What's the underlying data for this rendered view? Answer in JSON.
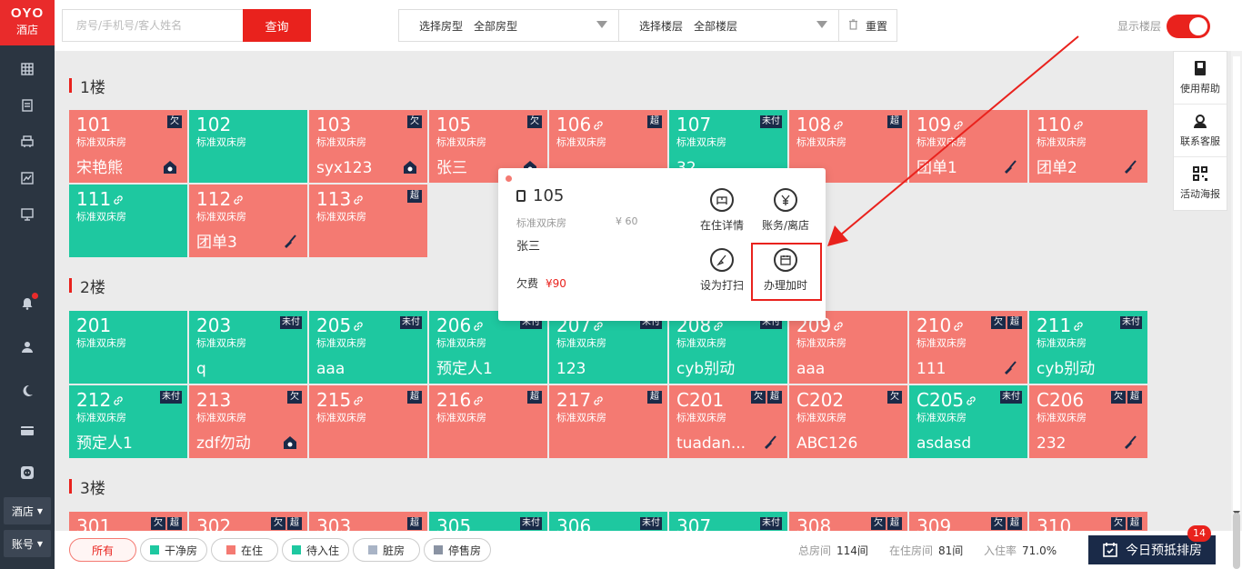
{
  "brand": {
    "line1": "OYO",
    "line2": "酒店"
  },
  "nav": {
    "hotel_label": "酒店",
    "account_label": "账号"
  },
  "topbar": {
    "search_placeholder": "房号/手机号/客人姓名",
    "query_label": "查询",
    "room_type_label": "选择房型",
    "room_type_value": "全部房型",
    "floor_label": "选择楼层",
    "floor_value": "全部楼层",
    "reset_label": "重置",
    "show_floor_label": "显示楼层"
  },
  "floors": [
    {
      "title": "1楼",
      "rooms": [
        {
          "num": "101",
          "type": "标准双床房",
          "guest": "宋艳熊",
          "color": "r",
          "badges": [
            "欠"
          ],
          "link": false,
          "icon": "home"
        },
        {
          "num": "102",
          "type": "标准双床房",
          "guest": "",
          "color": "c",
          "badges": [],
          "link": false,
          "icon": ""
        },
        {
          "num": "103",
          "type": "标准双床房",
          "guest": "syx123",
          "color": "r",
          "badges": [
            "欠"
          ],
          "link": false,
          "icon": "home"
        },
        {
          "num": "105",
          "type": "标准双床房",
          "guest": "张三",
          "color": "r",
          "badges": [
            "欠"
          ],
          "link": false,
          "icon": "home"
        },
        {
          "num": "106",
          "type": "标准双床房",
          "guest": "",
          "color": "r",
          "badges": [
            "超"
          ],
          "link": true,
          "icon": ""
        },
        {
          "num": "107",
          "type": "标准双床房",
          "guest": "32",
          "color": "c",
          "badges": [
            "未付"
          ],
          "link": false,
          "icon": ""
        },
        {
          "num": "108",
          "type": "标准双床房",
          "guest": "",
          "color": "r",
          "badges": [
            "超"
          ],
          "link": true,
          "icon": ""
        },
        {
          "num": "109",
          "type": "标准双床房",
          "guest": "团单1",
          "color": "r",
          "badges": [],
          "link": true,
          "icon": "broom"
        },
        {
          "num": "110",
          "type": "标准双床房",
          "guest": "团单2",
          "color": "r",
          "badges": [],
          "link": true,
          "icon": "broom"
        },
        {
          "num": "111",
          "type": "标准双床房",
          "guest": "",
          "color": "c",
          "badges": [],
          "link": true,
          "icon": ""
        },
        {
          "num": "112",
          "type": "标准双床房",
          "guest": "团单3",
          "color": "r",
          "badges": [],
          "link": true,
          "icon": "broom"
        },
        {
          "num": "113",
          "type": "标准双床房",
          "guest": "",
          "color": "r",
          "badges": [
            "超"
          ],
          "link": true,
          "icon": ""
        }
      ]
    },
    {
      "title": "2楼",
      "rooms": [
        {
          "num": "201",
          "type": "标准双床房",
          "guest": "",
          "color": "c",
          "badges": [],
          "link": false,
          "icon": ""
        },
        {
          "num": "203",
          "type": "标准双床房",
          "guest": "q",
          "color": "c",
          "badges": [
            "未付"
          ],
          "link": false,
          "icon": ""
        },
        {
          "num": "205",
          "type": "标准双床房",
          "guest": "aaa",
          "color": "c",
          "badges": [
            "未付"
          ],
          "link": true,
          "icon": ""
        },
        {
          "num": "206",
          "type": "标准双床房",
          "guest": "预定人1",
          "color": "c",
          "badges": [
            "未付"
          ],
          "link": true,
          "icon": ""
        },
        {
          "num": "207",
          "type": "标准双床房",
          "guest": "123",
          "color": "c",
          "badges": [
            "未付"
          ],
          "link": true,
          "icon": ""
        },
        {
          "num": "208",
          "type": "标准双床房",
          "guest": "cyb别动",
          "color": "c",
          "badges": [
            "未付"
          ],
          "link": true,
          "icon": ""
        },
        {
          "num": "209",
          "type": "标准双床房",
          "guest": "aaa",
          "color": "r",
          "badges": [],
          "link": true,
          "icon": ""
        },
        {
          "num": "210",
          "type": "标准双床房",
          "guest": "111",
          "color": "r",
          "badges": [
            "欠",
            "超"
          ],
          "link": true,
          "icon": "broom"
        },
        {
          "num": "211",
          "type": "标准双床房",
          "guest": "cyb别动",
          "color": "c",
          "badges": [
            "未付"
          ],
          "link": true,
          "icon": ""
        },
        {
          "num": "212",
          "type": "标准双床房",
          "guest": "预定人1",
          "color": "c",
          "badges": [
            "未付"
          ],
          "link": true,
          "icon": ""
        },
        {
          "num": "213",
          "type": "标准双床房",
          "guest": "zdf勿动",
          "color": "r",
          "badges": [
            "欠"
          ],
          "link": false,
          "icon": "home"
        },
        {
          "num": "215",
          "type": "标准双床房",
          "guest": "",
          "color": "r",
          "badges": [
            "超"
          ],
          "link": true,
          "icon": ""
        },
        {
          "num": "216",
          "type": "标准双床房",
          "guest": "",
          "color": "r",
          "badges": [
            "超"
          ],
          "link": true,
          "icon": ""
        },
        {
          "num": "217",
          "type": "标准双床房",
          "guest": "",
          "color": "r",
          "badges": [
            "超"
          ],
          "link": true,
          "icon": ""
        },
        {
          "num": "C201",
          "type": "标准双床房",
          "guest": "tuadan...",
          "color": "r",
          "badges": [
            "欠",
            "超"
          ],
          "link": false,
          "icon": "broom"
        },
        {
          "num": "C202",
          "type": "标准双床房",
          "guest": "ABC126",
          "color": "r",
          "badges": [
            "欠"
          ],
          "link": false,
          "icon": ""
        },
        {
          "num": "C205",
          "type": "标准双床房",
          "guest": "asdasd",
          "color": "c",
          "badges": [
            "未付"
          ],
          "link": true,
          "icon": ""
        },
        {
          "num": "C206",
          "type": "标准双床房",
          "guest": "232",
          "color": "r",
          "badges": [
            "欠",
            "超"
          ],
          "link": false,
          "icon": "broom"
        }
      ]
    },
    {
      "title": "3楼",
      "rooms": [
        {
          "num": "301",
          "type": "",
          "guest": "",
          "color": "r",
          "badges": [
            "欠",
            "超"
          ],
          "link": false,
          "icon": ""
        },
        {
          "num": "302",
          "type": "",
          "guest": "",
          "color": "r",
          "badges": [
            "欠",
            "超"
          ],
          "link": false,
          "icon": ""
        },
        {
          "num": "303",
          "type": "",
          "guest": "",
          "color": "r",
          "badges": [
            "超"
          ],
          "link": false,
          "icon": ""
        },
        {
          "num": "305",
          "type": "",
          "guest": "",
          "color": "c",
          "badges": [
            "未付"
          ],
          "link": false,
          "icon": ""
        },
        {
          "num": "306",
          "type": "",
          "guest": "",
          "color": "c",
          "badges": [
            "未付"
          ],
          "link": false,
          "icon": ""
        },
        {
          "num": "307",
          "type": "",
          "guest": "",
          "color": "c",
          "badges": [
            "未付"
          ],
          "link": false,
          "icon": ""
        },
        {
          "num": "308",
          "type": "",
          "guest": "",
          "color": "r",
          "badges": [
            "欠",
            "超"
          ],
          "link": false,
          "icon": ""
        },
        {
          "num": "309",
          "type": "",
          "guest": "",
          "color": "r",
          "badges": [
            "欠",
            "超"
          ],
          "link": false,
          "icon": ""
        },
        {
          "num": "310",
          "type": "",
          "guest": "",
          "color": "r",
          "badges": [
            "欠",
            "超"
          ],
          "link": false,
          "icon": ""
        }
      ]
    }
  ],
  "popup": {
    "room_num": "105",
    "room_type": "标准双床房",
    "price": "¥ 60",
    "guest": "张三",
    "owe_label": "欠费",
    "owe_amount": "¥90",
    "actions": {
      "stay_detail": "在住详情",
      "bill_checkout": "账务/离店",
      "set_clean": "设为打扫",
      "extend_time": "办理加时"
    }
  },
  "helper": {
    "help": "使用帮助",
    "service": "联系客服",
    "poster": "活动海报"
  },
  "legend": [
    {
      "label": "所有",
      "color": ""
    },
    {
      "label": "干净房",
      "color": "#1ec8a0"
    },
    {
      "label": "在住",
      "color": "#f47a72"
    },
    {
      "label": "待入住",
      "color": "#1ec8a0"
    },
    {
      "label": "脏房",
      "color": "#a9b4c6"
    },
    {
      "label": "停售房",
      "color": "#8a93a3"
    }
  ],
  "stats": {
    "total_label": "总房间",
    "total_value": "114间",
    "occupied_label": "在住房间",
    "occupied_value": "81间",
    "rate_label": "入住率",
    "rate_value": "71.0%"
  },
  "rank": {
    "label": "今日预抵排房",
    "badge": "14"
  },
  "colors": {
    "accent": "#e9221d",
    "clean": "#1ec8a0",
    "occupied": "#f47a72",
    "nav": "#2b3541",
    "badge": "#1a2a48"
  }
}
